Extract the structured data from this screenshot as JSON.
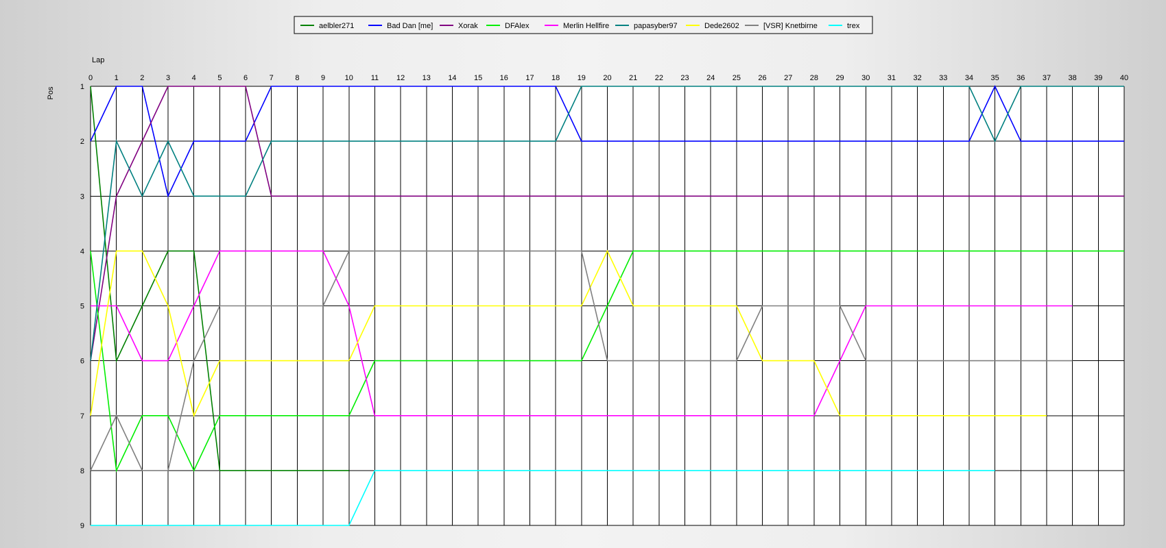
{
  "chart_data": {
    "type": "line",
    "xlabel": "Lap",
    "ylabel": "Pos",
    "xlim": [
      0,
      40
    ],
    "ylim": [
      1,
      9
    ],
    "y_inverted": true,
    "grid": true,
    "legend_position": "top-center",
    "x_ticks": [
      "0",
      "1",
      "2",
      "3",
      "4",
      "5",
      "6",
      "7",
      "8",
      "9",
      "10",
      "11",
      "12",
      "13",
      "14",
      "15",
      "16",
      "17",
      "18",
      "19",
      "20",
      "21",
      "22",
      "23",
      "24",
      "25",
      "26",
      "27",
      "28",
      "29",
      "30",
      "31",
      "32",
      "33",
      "34",
      "35",
      "36",
      "37",
      "38",
      "39",
      "40"
    ],
    "y_ticks": [
      "1",
      "2",
      "3",
      "4",
      "5",
      "6",
      "7",
      "8",
      "9"
    ],
    "series": [
      {
        "name": "aelbler271",
        "color": "#008000",
        "points": [
          [
            0,
            1
          ],
          [
            1,
            6
          ],
          [
            2,
            5
          ],
          [
            3,
            4
          ],
          [
            4,
            4
          ],
          [
            5,
            8
          ],
          [
            10,
            8
          ]
        ]
      },
      {
        "name": "Bad Dan [me]",
        "color": "#0000FF",
        "points": [
          [
            0,
            2
          ],
          [
            1,
            1
          ],
          [
            2,
            1
          ],
          [
            3,
            3
          ],
          [
            4,
            2
          ],
          [
            6,
            2
          ],
          [
            7,
            1
          ],
          [
            18,
            1
          ],
          [
            19,
            2
          ],
          [
            34,
            2
          ],
          [
            35,
            1
          ],
          [
            36,
            2
          ],
          [
            40,
            2
          ]
        ]
      },
      {
        "name": "Xorak",
        "color": "#800080",
        "points": [
          [
            0,
            6
          ],
          [
            1,
            3
          ],
          [
            2,
            2
          ],
          [
            3,
            1
          ],
          [
            6,
            1
          ],
          [
            7,
            3
          ],
          [
            40,
            3
          ]
        ]
      },
      {
        "name": "DFAlex",
        "color": "#00EE00",
        "points": [
          [
            0,
            4
          ],
          [
            1,
            8
          ],
          [
            2,
            7
          ],
          [
            3,
            7
          ],
          [
            4,
            8
          ],
          [
            5,
            7
          ],
          [
            10,
            7
          ],
          [
            11,
            6
          ],
          [
            19,
            6
          ],
          [
            20,
            5
          ],
          [
            21,
            4
          ],
          [
            40,
            4
          ]
        ]
      },
      {
        "name": "Merlin Hellfire",
        "color": "#FF00FF",
        "points": [
          [
            0,
            5
          ],
          [
            1,
            5
          ],
          [
            2,
            6
          ],
          [
            3,
            6
          ],
          [
            4,
            5
          ],
          [
            5,
            4
          ],
          [
            9,
            4
          ],
          [
            10,
            5
          ],
          [
            11,
            7
          ],
          [
            28,
            7
          ],
          [
            29,
            6
          ],
          [
            30,
            5
          ],
          [
            38,
            5
          ]
        ]
      },
      {
        "name": "papasyber97",
        "color": "#008080",
        "points": [
          [
            0,
            6
          ],
          [
            1,
            2
          ],
          [
            2,
            3
          ],
          [
            3,
            2
          ],
          [
            4,
            3
          ],
          [
            6,
            3
          ],
          [
            7,
            2
          ],
          [
            18,
            2
          ],
          [
            19,
            1
          ],
          [
            34,
            1
          ],
          [
            35,
            2
          ],
          [
            36,
            1
          ],
          [
            40,
            1
          ]
        ]
      },
      {
        "name": "Dede2602",
        "color": "#FFFF00",
        "points": [
          [
            0,
            7
          ],
          [
            1,
            4
          ],
          [
            2,
            4
          ],
          [
            3,
            5
          ],
          [
            4,
            7
          ],
          [
            5,
            6
          ],
          [
            10,
            6
          ],
          [
            11,
            5
          ],
          [
            19,
            5
          ],
          [
            20,
            4
          ],
          [
            21,
            5
          ],
          [
            25,
            5
          ],
          [
            26,
            6
          ],
          [
            28,
            6
          ],
          [
            29,
            7
          ],
          [
            37,
            7
          ]
        ]
      },
      {
        "name": "[VSR] Knetbirne",
        "color": "#808080",
        "points": [
          [
            0,
            8
          ],
          [
            1,
            7
          ],
          [
            2,
            8
          ],
          [
            3,
            8
          ],
          [
            4,
            6
          ],
          [
            5,
            5
          ],
          [
            9,
            5
          ],
          [
            10,
            4
          ],
          [
            19,
            4
          ],
          [
            20,
            6
          ],
          [
            25,
            6
          ],
          [
            26,
            5
          ],
          [
            29,
            5
          ],
          [
            30,
            6
          ],
          [
            38,
            6
          ]
        ]
      },
      {
        "name": "trex",
        "color": "#00FFFF",
        "points": [
          [
            0,
            9
          ],
          [
            10,
            9
          ],
          [
            11,
            8
          ],
          [
            35,
            8
          ]
        ]
      }
    ]
  }
}
